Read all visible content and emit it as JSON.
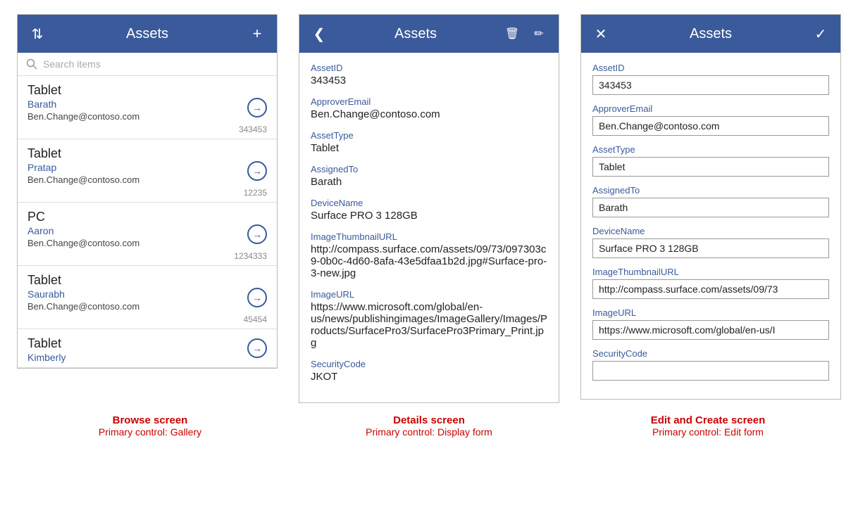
{
  "browse": {
    "header": {
      "title": "Assets",
      "sort_label": "sort-icon",
      "add_label": "add-icon"
    },
    "search": {
      "placeholder": "Search items"
    },
    "items": [
      {
        "title": "Tablet",
        "name": "Barath",
        "email": "Ben.Change@contoso.com",
        "id": "343453"
      },
      {
        "title": "Tablet",
        "name": "Pratap",
        "email": "Ben.Change@contoso.com",
        "id": "12235"
      },
      {
        "title": "PC",
        "name": "Aaron",
        "email": "Ben.Change@contoso.com",
        "id": "1234333"
      },
      {
        "title": "Tablet",
        "name": "Saurabh",
        "email": "Ben.Change@contoso.com",
        "id": "45454"
      },
      {
        "title": "Tablet",
        "name": "Kimberly",
        "email": "",
        "id": ""
      }
    ]
  },
  "details": {
    "header": {
      "title": "Assets"
    },
    "fields": [
      {
        "label": "AssetID",
        "value": "343453"
      },
      {
        "label": "ApproverEmail",
        "value": "Ben.Change@contoso.com"
      },
      {
        "label": "AssetType",
        "value": "Tablet"
      },
      {
        "label": "AssignedTo",
        "value": "Barath"
      },
      {
        "label": "DeviceName",
        "value": "Surface PRO 3 128GB"
      },
      {
        "label": "ImageThumbnailURL",
        "value": "http://compass.surface.com/assets/09/73/097303c9-0b0c-4d60-8afa-43e5dfaa1b2d.jpg#Surface-pro-3-new.jpg"
      },
      {
        "label": "ImageURL",
        "value": "https://www.microsoft.com/global/en-us/news/publishingimages/ImageGallery/Images/Products/SurfacePro3/SurfacePro3Primary_Print.jpg"
      },
      {
        "label": "SecurityCode",
        "value": "JKOT"
      }
    ]
  },
  "edit": {
    "header": {
      "title": "Assets"
    },
    "fields": [
      {
        "label": "AssetID",
        "value": "343453"
      },
      {
        "label": "ApproverEmail",
        "value": "Ben.Change@contoso.com"
      },
      {
        "label": "AssetType",
        "value": "Tablet"
      },
      {
        "label": "AssignedTo",
        "value": "Barath"
      },
      {
        "label": "DeviceName",
        "value": "Surface PRO 3 128GB"
      },
      {
        "label": "ImageThumbnailURL",
        "value": "http://compass.surface.com/assets/09/73"
      },
      {
        "label": "ImageURL",
        "value": "https://www.microsoft.com/global/en-us/I"
      },
      {
        "label": "SecurityCode",
        "value": ""
      }
    ]
  },
  "captions": [
    {
      "main": "Browse screen",
      "sub": "Primary control: Gallery"
    },
    {
      "main": "Details screen",
      "sub": "Primary control: Display form"
    },
    {
      "main": "Edit and Create screen",
      "sub": "Primary control: Edit form"
    }
  ]
}
